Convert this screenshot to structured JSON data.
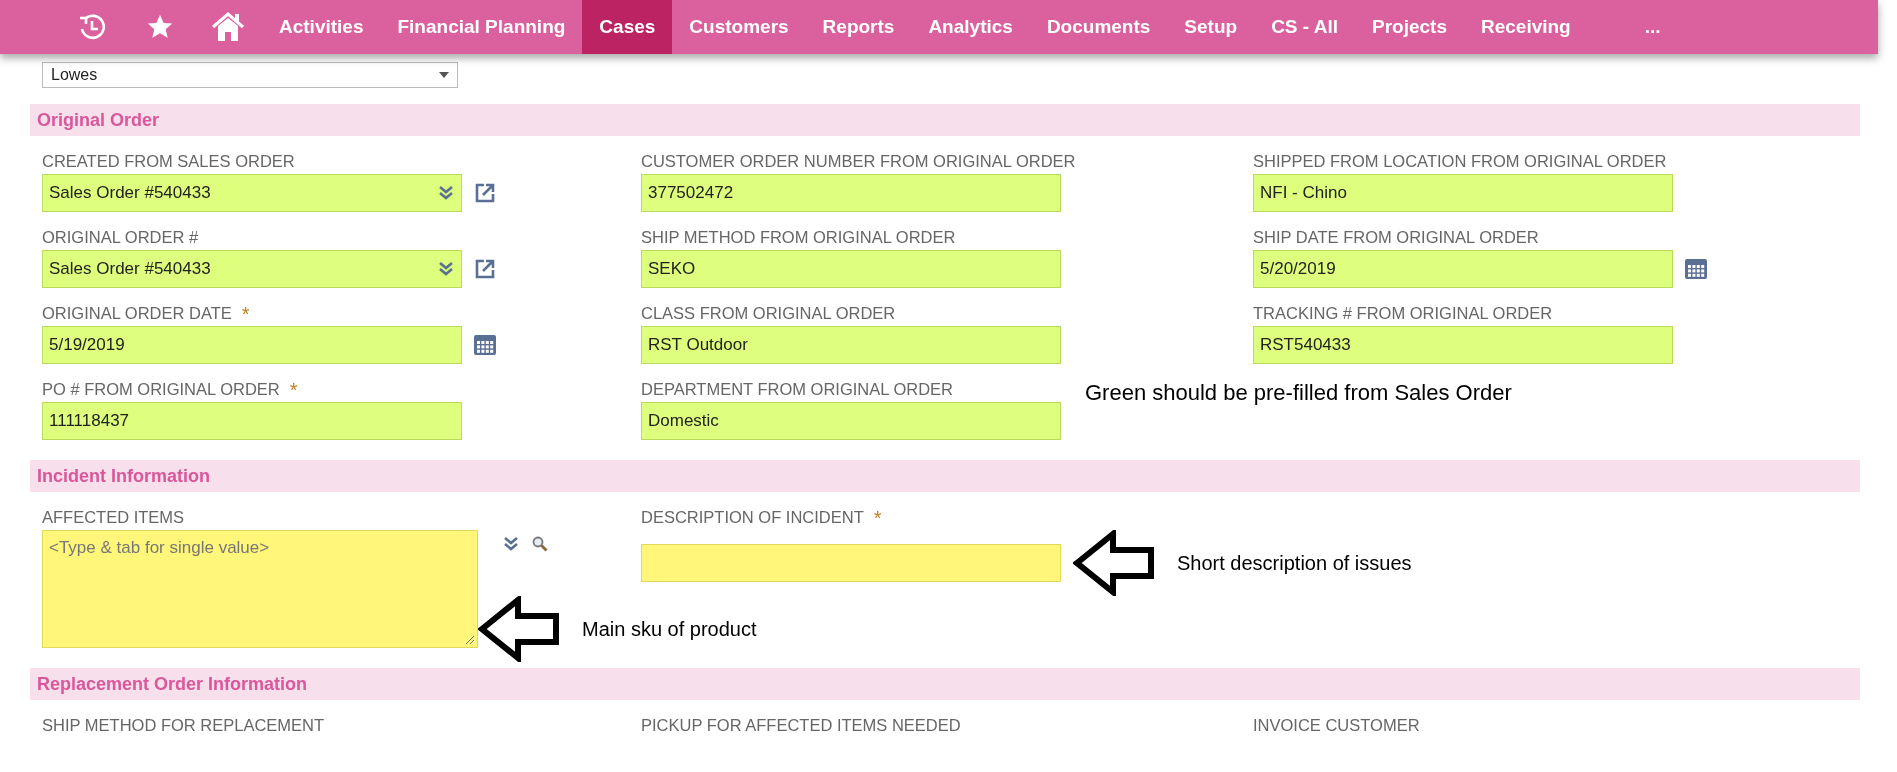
{
  "nav": {
    "items": [
      {
        "label": "Activities",
        "selected": false
      },
      {
        "label": "Financial Planning",
        "selected": false
      },
      {
        "label": "Cases",
        "selected": true
      },
      {
        "label": "Customers",
        "selected": false
      },
      {
        "label": "Reports",
        "selected": false
      },
      {
        "label": "Analytics",
        "selected": false
      },
      {
        "label": "Documents",
        "selected": false
      },
      {
        "label": "Setup",
        "selected": false
      },
      {
        "label": "CS - All",
        "selected": false
      },
      {
        "label": "Projects",
        "selected": false
      },
      {
        "label": "Receiving",
        "selected": false
      },
      {
        "label": "...",
        "selected": false
      }
    ]
  },
  "top_select": {
    "value": "Lowes"
  },
  "sections": [
    {
      "title": "Original Order",
      "columns": [
        [
          {
            "kind": "select",
            "label": "CREATED FROM SALES ORDER",
            "value": "Sales Order #540433",
            "prefilled": true
          },
          {
            "kind": "select",
            "label": "ORIGINAL ORDER #",
            "value": "Sales Order #540433",
            "prefilled": true
          },
          {
            "kind": "date",
            "label": "ORIGINAL ORDER DATE",
            "value": "5/19/2019",
            "required_mark": "*",
            "prefilled": true
          },
          {
            "kind": "text",
            "label": "PO # FROM ORIGINAL ORDER",
            "value": "111118437",
            "required_mark": "*",
            "prefilled": true
          }
        ],
        [
          {
            "kind": "text",
            "label": "CUSTOMER ORDER NUMBER FROM ORIGINAL ORDER",
            "value": "377502472",
            "prefilled": true
          },
          {
            "kind": "text",
            "label": "SHIP METHOD FROM ORIGINAL ORDER",
            "value": "SEKO",
            "prefilled": true
          },
          {
            "kind": "text",
            "label": "CLASS FROM ORIGINAL ORDER",
            "value": "RST Outdoor",
            "prefilled": true
          },
          {
            "kind": "text",
            "label": "DEPARTMENT FROM ORIGINAL ORDER",
            "value": "Domestic",
            "prefilled": true
          }
        ],
        [
          {
            "kind": "text",
            "label": "SHIPPED FROM LOCATION FROM ORIGINAL ORDER",
            "value": "NFI - Chino",
            "prefilled": true
          },
          {
            "kind": "date",
            "label": "SHIP DATE FROM ORIGINAL ORDER",
            "value": "5/20/2019",
            "prefilled": true
          },
          {
            "kind": "text",
            "label": "TRACKING # FROM ORIGINAL ORDER",
            "value": "RST540433",
            "prefilled": true
          },
          {
            "kind": "note",
            "text": "Green should be pre-filled from Sales Order"
          }
        ]
      ]
    },
    {
      "title": "Incident Information",
      "columns": [
        [
          {
            "kind": "multiselect",
            "label": "AFFECTED ITEMS",
            "placeholder": "<Type & tab for single value>",
            "prefilled": false,
            "note": "Main sku of product"
          }
        ],
        [
          {
            "kind": "text",
            "label": "DESCRIPTION OF INCIDENT",
            "required_mark": "*",
            "prefilled": false,
            "note": "Short description of issues"
          }
        ],
        []
      ]
    },
    {
      "title": "Replacement Order Information",
      "columns": [
        [
          {
            "kind": "label",
            "label": "SHIP METHOD FOR REPLACEMENT"
          }
        ],
        [
          {
            "kind": "label",
            "label": "PICKUP FOR AFFECTED ITEMS NEEDED"
          }
        ],
        [
          {
            "kind": "label",
            "label": "INVOICE CUSTOMER"
          }
        ]
      ]
    }
  ]
}
